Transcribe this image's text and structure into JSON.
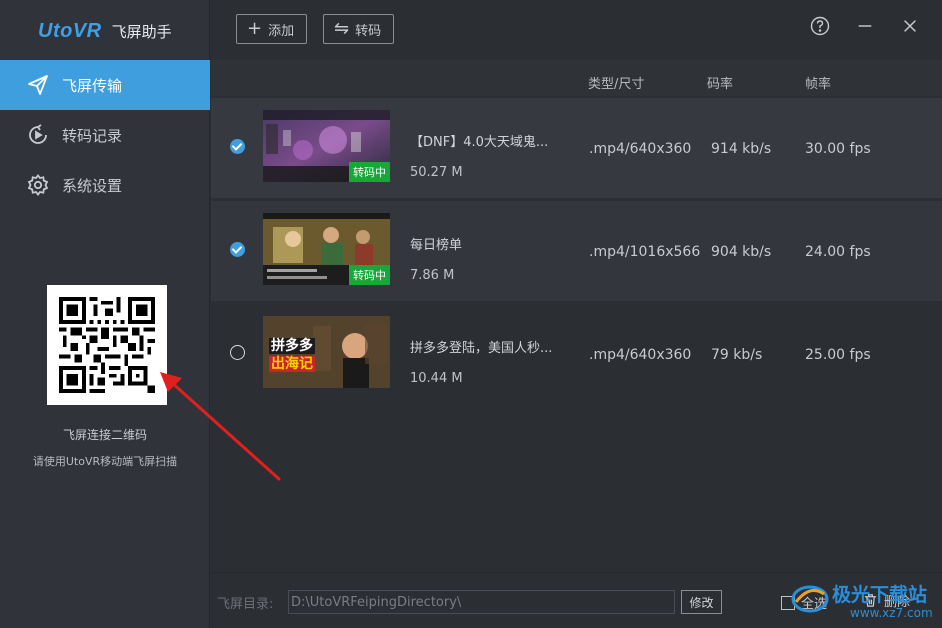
{
  "app": {
    "logo": "UtoVR",
    "name": "飞屏助手"
  },
  "sidebar": {
    "items": [
      {
        "label": "飞屏传输",
        "icon": "send-icon",
        "active": true
      },
      {
        "label": "转码记录",
        "icon": "play-history-icon",
        "active": false
      },
      {
        "label": "系统设置",
        "icon": "gear-icon",
        "active": false
      }
    ],
    "qr_caption": "飞屏连接二维码",
    "qr_hint": "请使用UtoVR移动端飞屏扫描"
  },
  "toolbar": {
    "add_label": "添加",
    "transcode_label": "转码"
  },
  "table": {
    "headers": {
      "type_size": "类型/尺寸",
      "bitrate": "码率",
      "framerate": "帧率"
    },
    "rows": [
      {
        "checked": true,
        "title": "【DNF】4.0大天域鬼...",
        "size": "50.27 M",
        "format": ".mp4/640x360",
        "bitrate": "914 kb/s",
        "fps": "30.00 fps",
        "badge": "转码中"
      },
      {
        "checked": true,
        "title": "每日榜单",
        "size": "7.86 M",
        "format": ".mp4/1016x566",
        "bitrate": "904 kb/s",
        "fps": "24.00 fps",
        "badge": "转码中"
      },
      {
        "checked": false,
        "title": "拼多多登陆，美国人秒...",
        "size": "10.44 M",
        "format": ".mp4/640x360",
        "bitrate": "79 kb/s",
        "fps": "25.00 fps",
        "thumb_text_1": "拼多多",
        "thumb_text_2": "出海记"
      }
    ]
  },
  "footer": {
    "dir_label": "飞屏目录:",
    "dir_value": "D:\\UtoVRFeipingDirectory\\",
    "modify_label": "修改",
    "select_all_label": "全选",
    "delete_label": "删除"
  },
  "watermark": {
    "text": "极光下载站",
    "url": "www.xz7.com"
  },
  "colors": {
    "accent": "#3e9ede",
    "badge": "#16a83a",
    "annotation_arrow": "#e0201e"
  }
}
